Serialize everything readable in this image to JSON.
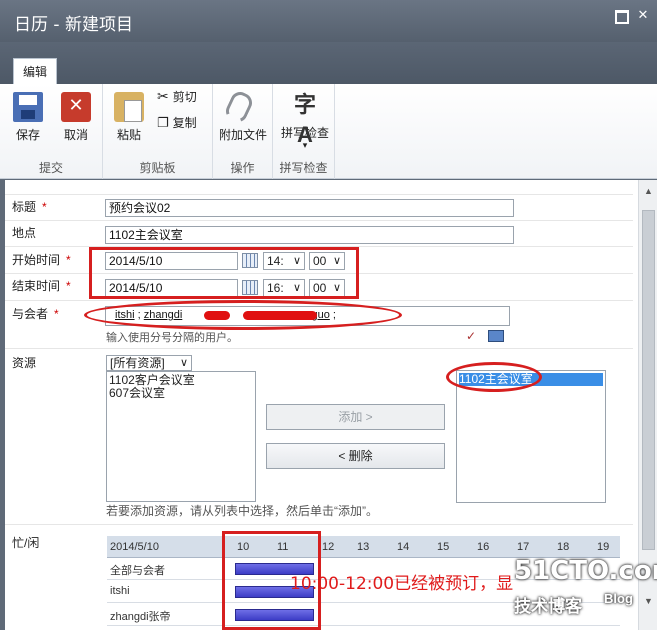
{
  "window": {
    "title": "日历 - 新建项目"
  },
  "ribbon": {
    "tab_label": "编辑",
    "groups": {
      "submit": {
        "label": "提交",
        "save": "保存",
        "cancel": "取消"
      },
      "clipboard": {
        "label": "剪贴板",
        "paste": "粘贴",
        "cut": "剪切",
        "copy": "复制"
      },
      "actions": {
        "label": "操作",
        "attach": "附加文件"
      },
      "spelling": {
        "label": "拼写检查",
        "spellcheck": "拼写检查",
        "spellcheck_sub": "▾"
      }
    }
  },
  "form": {
    "title": {
      "label": "标题",
      "value": "预约会议02"
    },
    "location": {
      "label": "地点",
      "value": "1102主会议室"
    },
    "start": {
      "label": "开始时间",
      "date": "2014/5/10",
      "hour": "14:",
      "minute": "00"
    },
    "end": {
      "label": "结束时间",
      "date": "2014/5/10",
      "hour": "16:",
      "minute": "00"
    },
    "attendees": {
      "label": "与会者",
      "names": [
        "itshi",
        "zhangdi",
        "enxuguo"
      ],
      "separator": ";",
      "hint": "输入使用分号分隔的用户。"
    },
    "resources": {
      "label": "资源",
      "filter": "[所有资源]",
      "available": [
        "1102客户会议室",
        "607会议室"
      ],
      "add_button": "添加 >",
      "remove_button": "< 删除",
      "selected": [
        "1102主会议室"
      ],
      "hint": "若要添加资源，请从列表中选择，然后单击“添加”。"
    },
    "freebusy": {
      "label": "忙/闲",
      "date": "2014/5/10",
      "hours": [
        "10",
        "11",
        "12",
        "13",
        "14",
        "15",
        "16",
        "17",
        "18",
        "19"
      ],
      "rows": [
        "全部与会者",
        "itshi",
        "zhangdi张帝"
      ]
    }
  },
  "annotation": {
    "text": "10:00-12:00已经被预订，显"
  },
  "watermark": {
    "site": "51CTO.com",
    "sub": "技术博客",
    "blog": "Blog"
  },
  "colors": {
    "required": "#cc0000",
    "highlight": "#d61f1f",
    "busy_bar": "#3d3dc6"
  }
}
